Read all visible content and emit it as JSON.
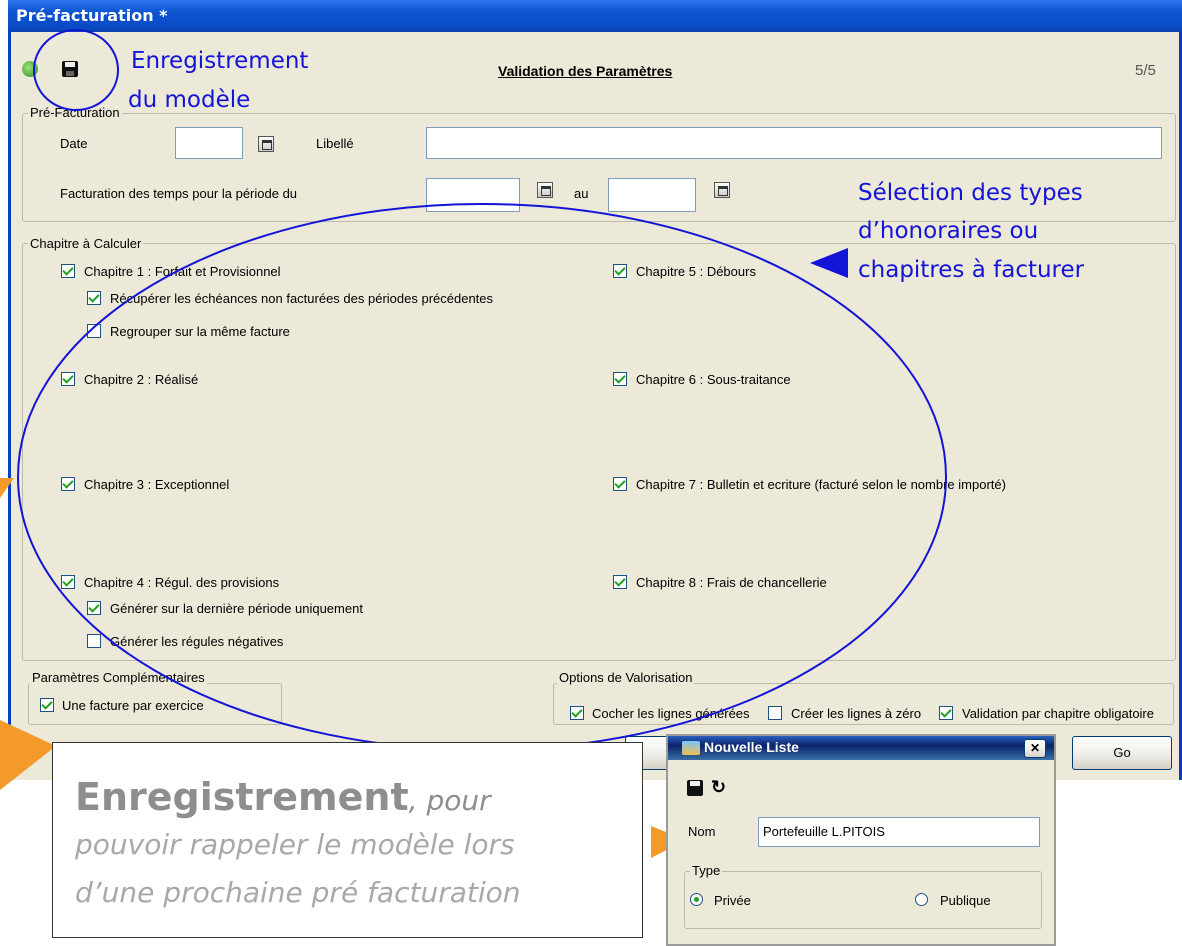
{
  "window": {
    "title": "Pré-facturation *",
    "page_title": "Validation des Paramètres",
    "step": "5/5"
  },
  "prefacturation": {
    "legend": "Pré-Facturation",
    "date_label": "Date",
    "libelle_label": "Libellé",
    "periode_label": "Facturation des temps pour la période du",
    "au_label": "au",
    "date_value": "",
    "libelle_value": "",
    "from_value": "",
    "to_value": ""
  },
  "chapitres": {
    "legend": "Chapitre à Calculer",
    "items": [
      {
        "label": "Chapitre 1 : Forfait et Provisionnel",
        "checked": true
      },
      {
        "label": "Récupérer les échéances non facturées des périodes précédentes",
        "checked": true
      },
      {
        "label": "Regrouper sur la même facture",
        "checked": false
      },
      {
        "label": "Chapitre 2 : Réalisé",
        "checked": true
      },
      {
        "label": "Chapitre 3 : Exceptionnel",
        "checked": true
      },
      {
        "label": "Chapitre 4 : Régul. des provisions",
        "checked": true
      },
      {
        "label": "Générer sur la dernière période uniquement",
        "checked": true
      },
      {
        "label": "Générer les régules négatives",
        "checked": false
      },
      {
        "label": "Chapitre 5 : Débours",
        "checked": true
      },
      {
        "label": "Chapitre 6 : Sous-traitance",
        "checked": true
      },
      {
        "label": "Chapitre 7 : Bulletin et ecriture (facturé selon le nombre importé)",
        "checked": true
      },
      {
        "label": "Chapitre 8 : Frais de chancellerie",
        "checked": true
      }
    ]
  },
  "complementaires": {
    "legend": "Paramètres Complémentaires",
    "item": "Une facture par exercice",
    "checked": true
  },
  "valorisation": {
    "legend": "Options de Valorisation",
    "items": [
      {
        "label": "Cocher les lignes générées",
        "checked": true
      },
      {
        "label": "Créer les lignes à zéro",
        "checked": false
      },
      {
        "label": "Validation par chapitre obligatoire",
        "checked": true
      }
    ]
  },
  "buttons": {
    "go": "Go"
  },
  "annotations": {
    "save_line1": "Enregistrement",
    "save_line2": "du modèle",
    "types_line1": "Sélection des types",
    "types_line2": "d’honoraires ou",
    "types_line3": "chapitres à facturer",
    "callout_bold": "Enregistrement",
    "callout_line1": ", pour",
    "callout_line2": "pouvoir rappeler le modèle  lors",
    "callout_line3": "d’une prochaine pré facturation"
  },
  "dialog": {
    "title": "Nouvelle Liste",
    "close": "✕",
    "nom_label": "Nom",
    "nom_value": "Portefeuille L.PITOIS",
    "type_legend": "Type",
    "radio_private": "Privée",
    "radio_public": "Publique",
    "selected": "Privée"
  },
  "colors": {
    "annotation_blue": "#1414D8",
    "arrow_orange": "#F39A2B",
    "title_blue": "#0A4BC4",
    "window_bg": "#ECE9D8"
  }
}
